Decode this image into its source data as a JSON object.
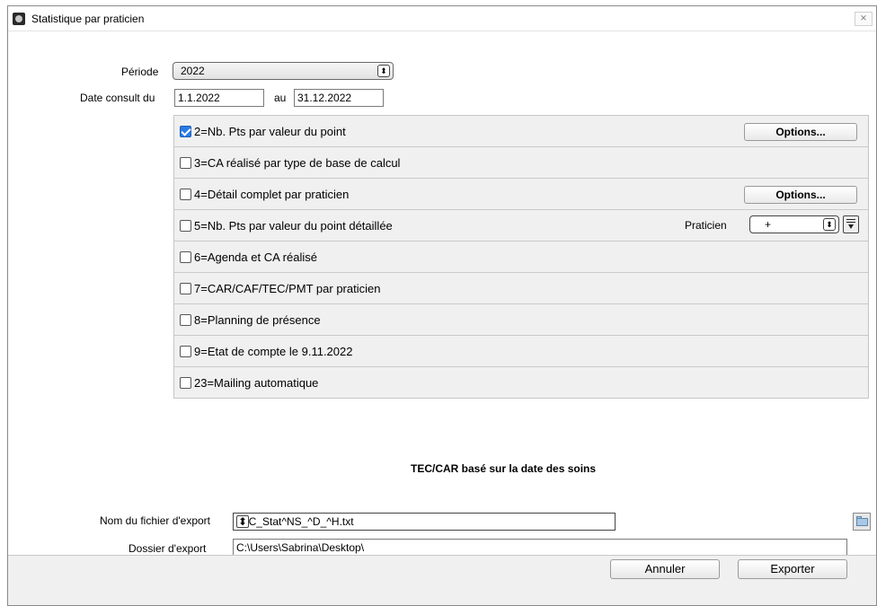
{
  "window": {
    "title": "Statistique par praticien",
    "close_glyph": "⨯"
  },
  "periode": {
    "label": "Période",
    "value": "2022"
  },
  "dates": {
    "label": "Date consult du",
    "from": "1.1.2022",
    "to_label": "au",
    "to": "31.12.2022"
  },
  "options": [
    {
      "label": "2=Nb. Pts par valeur du point",
      "checked": true,
      "button": "Options..."
    },
    {
      "label": "3=CA réalisé par type de base de calcul",
      "checked": false
    },
    {
      "label": "4=Détail complet par praticien",
      "checked": false,
      "button": "Options..."
    },
    {
      "label": "5=Nb. Pts par valeur du point détaillée",
      "checked": false,
      "praticien_label": "Praticien",
      "praticien_value": "+"
    },
    {
      "label": "6=Agenda et CA réalisé",
      "checked": false
    },
    {
      "label": "7=CAR/CAF/TEC/PMT par praticien",
      "checked": false
    },
    {
      "label": "8=Planning de présence",
      "checked": false
    },
    {
      "label": "9=Etat de compte le 9.11.2022",
      "checked": false
    },
    {
      "label": "23=Mailing automatique",
      "checked": false
    }
  ],
  "export": {
    "section_title": "TEC/CAR basé sur la date des soins",
    "file_label": "Nom du fichier d'export",
    "file_value": "^SC_Stat^NS_^D_^H.txt",
    "folder_label": "Dossier d'export",
    "folder_value": "C:\\Users\\Sabrina\\Desktop\\"
  },
  "footer": {
    "cancel": "Annuler",
    "export": "Exporter"
  },
  "colors": {
    "checked": "#2a7be4",
    "panel_bg": "#f0f0f0"
  },
  "icons": {
    "stepper": "up-down-stepper-icon",
    "filter": "filter-icon",
    "folder": "folder-icon"
  }
}
